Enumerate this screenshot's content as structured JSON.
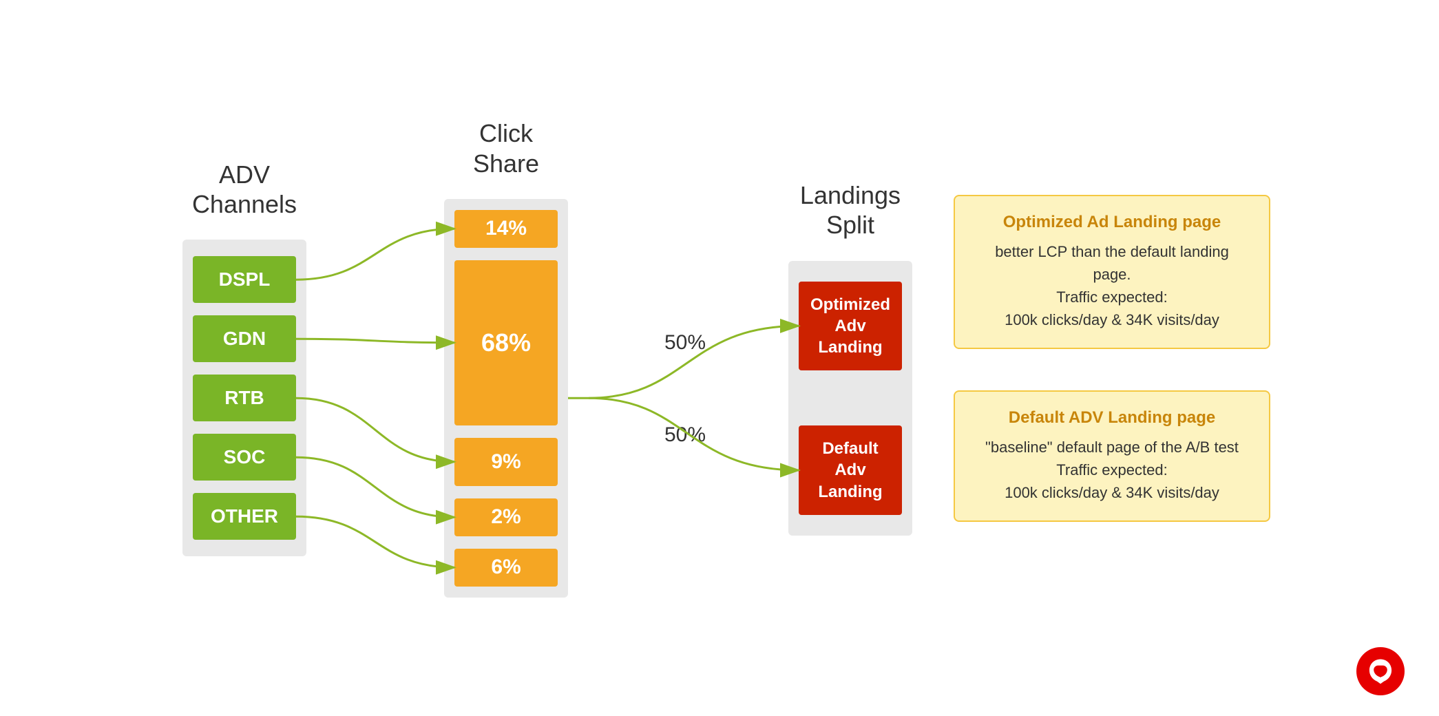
{
  "adv": {
    "header": "ADV\nChannels",
    "channels": [
      "DSPL",
      "GDN",
      "RTB",
      "SOC",
      "OTHER"
    ]
  },
  "click": {
    "header": "Click\nShare",
    "shares": [
      {
        "label": "14%",
        "size": "medium"
      },
      {
        "label": "68%",
        "size": "large"
      },
      {
        "label": "9%",
        "size": "medium"
      },
      {
        "label": "2%",
        "size": "small"
      },
      {
        "label": "6%",
        "size": "small"
      }
    ]
  },
  "landings": {
    "header": "Landings\nSplit",
    "items": [
      "Optimized\nAdv\nLanding",
      "Default\nAdv\nLanding"
    ],
    "splits": [
      "50%",
      "50%"
    ]
  },
  "cards": [
    {
      "title": "Optimized Ad Landing page",
      "body": "better LCP than the default landing page.\nTraffic expected:\n100k clicks/day  & 34K visits/day"
    },
    {
      "title": "Default ADV Landing page",
      "body": "\"baseline\" default page of the A/B test\nTraffic expected:\n100k clicks/day  & 34K visits/day"
    }
  ]
}
